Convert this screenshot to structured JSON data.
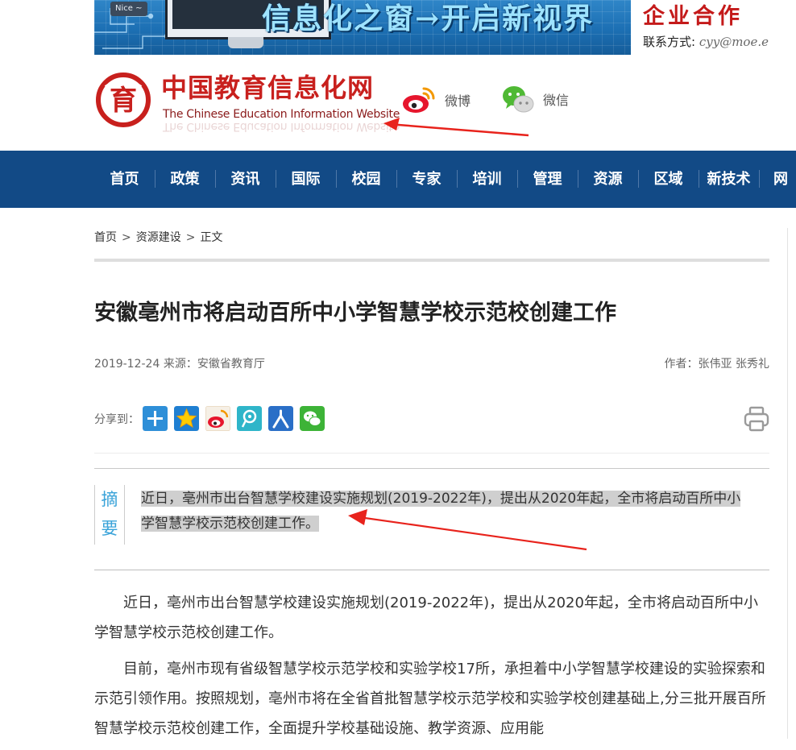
{
  "banner": {
    "badge": "Nice ~",
    "slogan": "信息化之窗→开启新视界",
    "coop_title": "企业合作",
    "contact_label": "联系方式:",
    "contact_email": "cyy@moe.e"
  },
  "site": {
    "name_cn": "中国教育信息化网",
    "name_en": "The Chinese Education Information Website",
    "logo_glyph": "育",
    "social": [
      {
        "icon": "weibo-icon",
        "label": "微博"
      },
      {
        "icon": "wechat-icon",
        "label": "微信"
      }
    ]
  },
  "nav": {
    "items": [
      "首页",
      "政策",
      "资讯",
      "国际",
      "校园",
      "专家",
      "培训",
      "管理",
      "资源",
      "区域",
      "新技术",
      "网"
    ]
  },
  "breadcrumb": {
    "home": "首页",
    "sep": ">",
    "section": "资源建设",
    "current": "正文"
  },
  "article": {
    "title": "安徽亳州市将启动百所中小学智慧学校示范校创建工作",
    "date": "2019-12-24",
    "source": "来源：安徽省教育厅",
    "author": "作者：张伟亚 张秀礼",
    "share_label": "分享到：",
    "share_icons": [
      "more-share-icon",
      "qzone-icon",
      "sina-weibo-icon",
      "tencent-weibo-icon",
      "renren-icon",
      "wechat-share-icon"
    ],
    "summary_label": "摘要",
    "summary": "近日，亳州市出台智慧学校建设实施规划(2019-2022年)，提出从2020年起，全市将启动百所中小学智慧学校示范校创建工作。",
    "paragraphs": [
      "近日，亳州市出台智慧学校建设实施规划(2019-2022年)，提出从2020年起，全市将启动百所中小学智慧学校示范校创建工作。",
      "目前，亳州市现有省级智慧学校示范学校和实验学校17所，承担着中小学智慧学校建设的实验探索和示范引领作用。按照规划，亳州市将在全省首批智慧学校示范学校和实验学校创建基础上,分三批开展百所智慧学校示范校创建工作，全面提升学校基础设施、教学资源、应用能"
    ]
  },
  "colors": {
    "nav_bg": "#124a86",
    "brand_red": "#c8201d",
    "summary_label": "#3aa3d9",
    "annotation_red": "#e8231c"
  }
}
